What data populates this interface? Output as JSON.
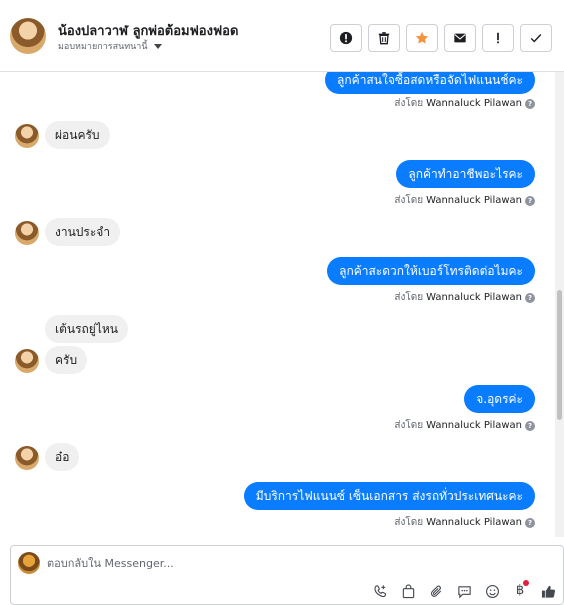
{
  "header": {
    "contact_name": "น้องปลาวาฬ ลูกพ่อต้อมฟองฟอด",
    "assign_label": "มอบหมายการสนทนานี้",
    "actions": [
      {
        "icon": "alert-circle-icon",
        "name": "mark-spam-button"
      },
      {
        "icon": "trash-icon",
        "name": "delete-button"
      },
      {
        "icon": "star-icon",
        "name": "star-button"
      },
      {
        "icon": "envelope-icon",
        "name": "mark-unread-button"
      },
      {
        "icon": "exclamation-icon",
        "name": "follow-up-button"
      },
      {
        "icon": "check-icon",
        "name": "mark-done-button"
      }
    ]
  },
  "messages": [
    {
      "dir": "out",
      "text": "ลูกค้าสนใจซื้อสดหรือจัดไฟแนนช์คะ",
      "sent_by_label": "ส่งโดย",
      "sender": "Wannaluck Pilawan"
    },
    {
      "dir": "in",
      "text": "ผ่อนครับ"
    },
    {
      "dir": "out",
      "text": "ลูกค้าทำอาชีพอะไรคะ",
      "sent_by_label": "ส่งโดย",
      "sender": "Wannaluck Pilawan"
    },
    {
      "dir": "in",
      "text": "งานประจำ"
    },
    {
      "dir": "out",
      "text": "ลูกค้าสะดวกให้เบอร์โทรติดต่อไมคะ",
      "sent_by_label": "ส่งโดย",
      "sender": "Wannaluck Pilawan"
    },
    {
      "dir": "in",
      "text": "เต้นรถยู่ไหน"
    },
    {
      "dir": "in",
      "text": "ครับ"
    },
    {
      "dir": "out",
      "text": "จ.อุดรค่ะ",
      "sent_by_label": "ส่งโดย",
      "sender": "Wannaluck Pilawan"
    },
    {
      "dir": "in",
      "text": "อ๋อ"
    },
    {
      "dir": "out",
      "text": "มีบริการไฟแนนซ์ เซ็นเอกสาร ส่งรถทั่วประเทศนะคะ",
      "sent_by_label": "ส่งโดย",
      "sender": "Wannaluck Pilawan"
    }
  ],
  "composer": {
    "placeholder": "ตอบกลับใน Messenger...",
    "tools": [
      "phone-add-icon",
      "shopping-bag-icon",
      "paperclip-icon",
      "saved-reply-icon",
      "emoji-icon",
      "baht-icon",
      "like-icon"
    ],
    "baht_symbol": "฿"
  },
  "colors": {
    "outgoing_bubble": "#0a7cff",
    "incoming_bubble": "#f0f0f0",
    "star": "#f7923a",
    "like": "#444950",
    "notification_dot": "#e41e3f"
  }
}
